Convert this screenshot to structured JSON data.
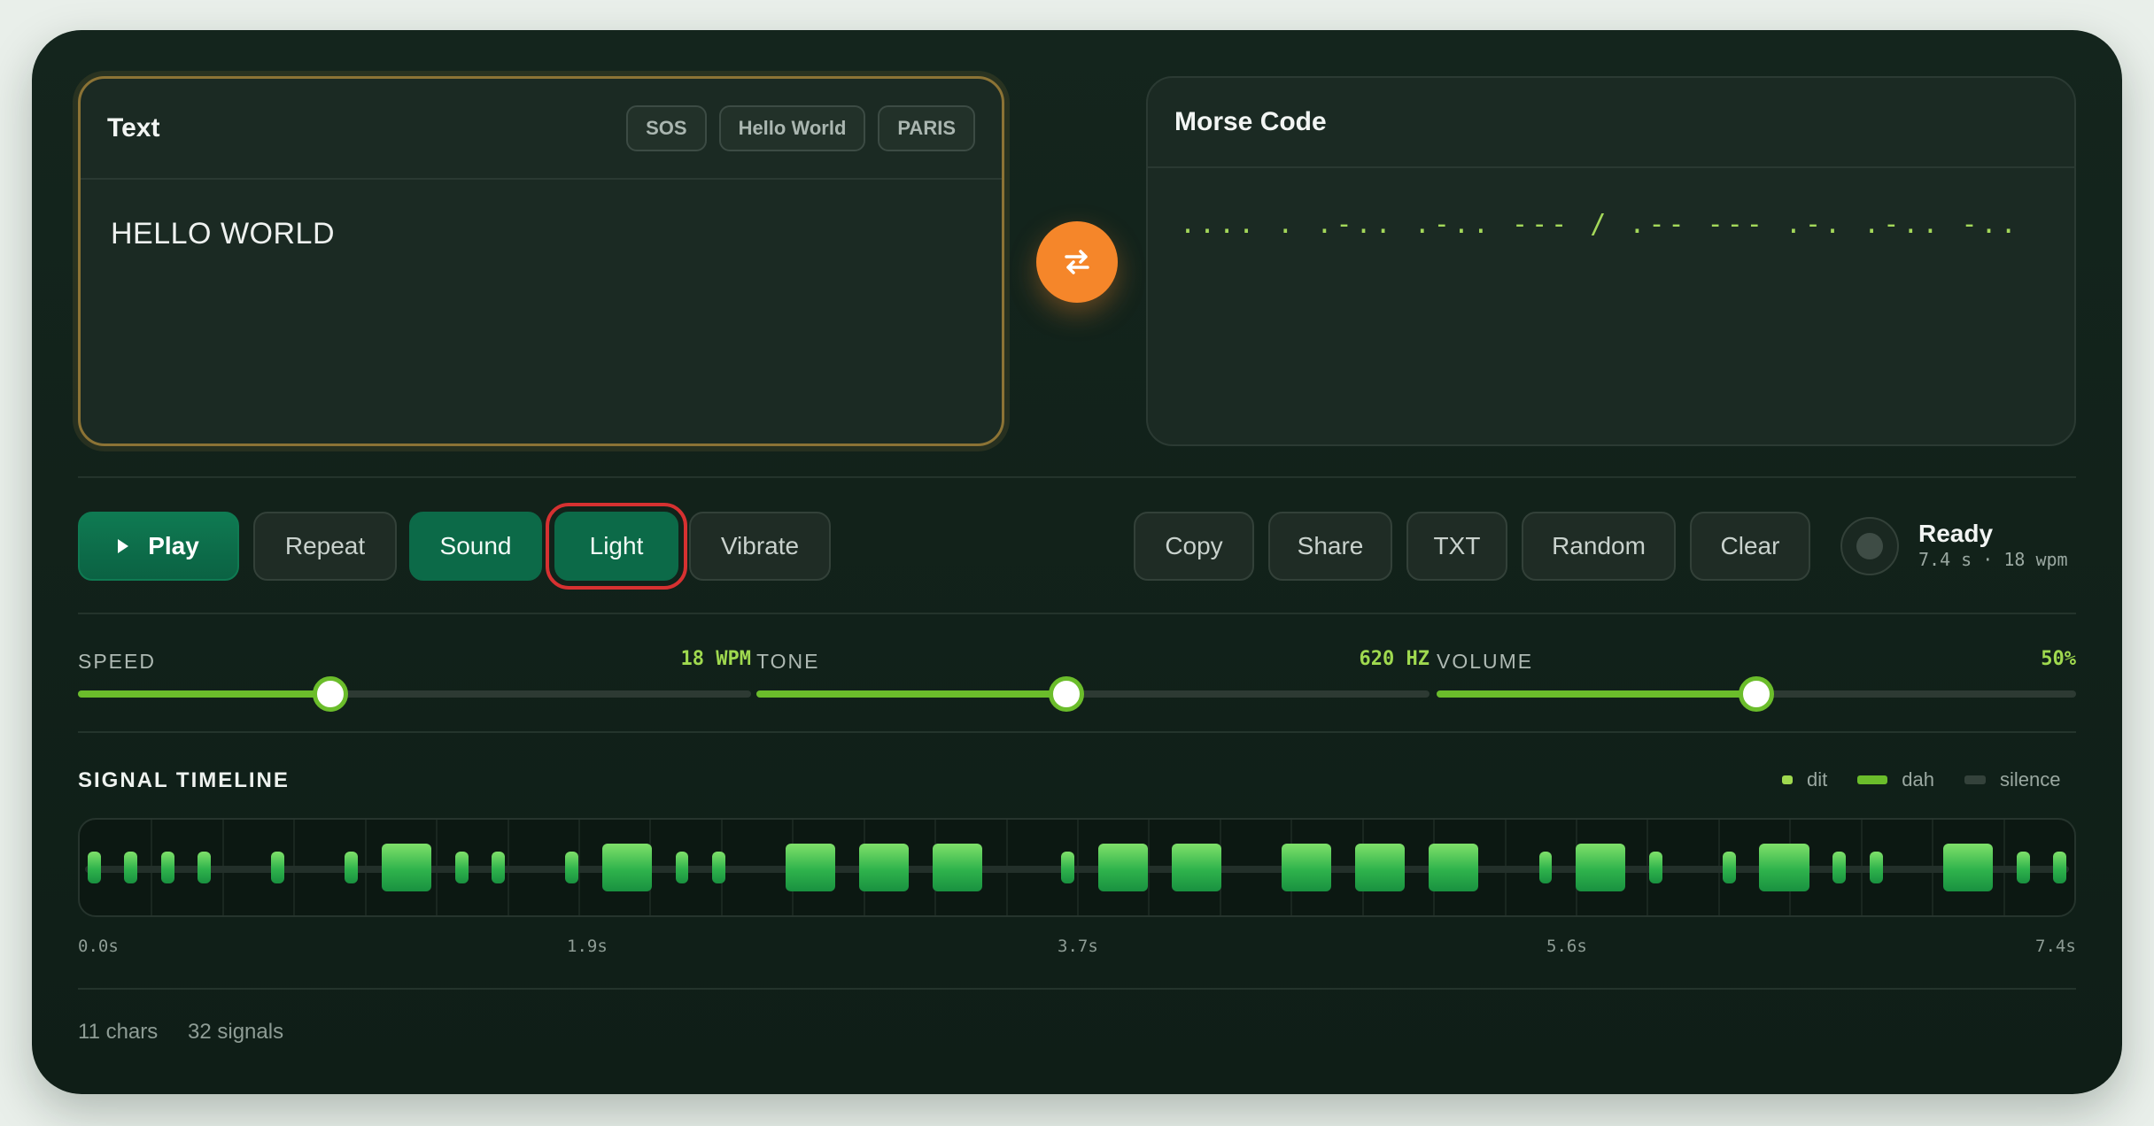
{
  "input": {
    "title": "Text",
    "presets": [
      "SOS",
      "Hello World",
      "PARIS"
    ],
    "value": "HELLO WORLD"
  },
  "output": {
    "title": "Morse Code",
    "value": ".... . .-.. .-.. --- / .-- --- .-. .-.. -.."
  },
  "swap_icon": "swap-arrows-icon",
  "controls": {
    "play": "Play",
    "repeat": "Repeat",
    "sound": "Sound",
    "light": "Light",
    "vibrate": "Vibrate",
    "copy": "Copy",
    "share": "Share",
    "txt": "TXT",
    "random": "Random",
    "clear": "Clear"
  },
  "status": {
    "title": "Ready",
    "detail": "7.4 s · 18 wpm"
  },
  "sliders": [
    {
      "label": "SPEED",
      "value_text": "18 WPM",
      "fraction": 0.375
    },
    {
      "label": "TONE",
      "value_text": "620 HZ",
      "fraction": 0.46
    },
    {
      "label": "VOLUME",
      "value_text": "50%",
      "fraction": 0.5
    }
  ],
  "timeline": {
    "title": "SIGNAL TIMELINE",
    "legend": {
      "dit": "dit",
      "dah": "dah",
      "silence": "silence"
    },
    "axis": [
      "0.0s",
      "1.9s",
      "3.7s",
      "5.6s",
      "7.4s"
    ],
    "signals": "....|.|.-..|.-..|---|/|.--|---|.-.|.-..|-.."
  },
  "footer": {
    "chars": "11 chars",
    "signals": "32 signals"
  },
  "colors": {
    "accent_green": "#6bbd2b",
    "swap_orange": "#f5862a",
    "focus_red": "#d63131"
  }
}
